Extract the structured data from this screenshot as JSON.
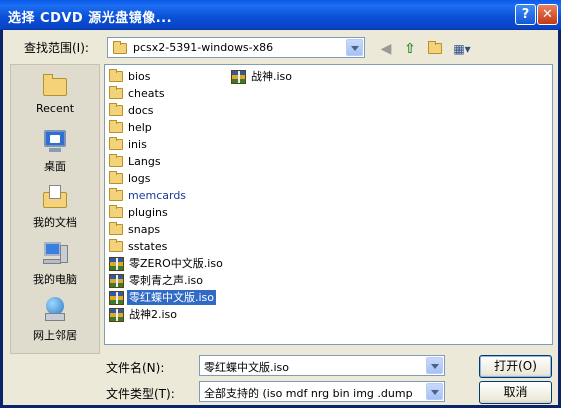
{
  "window": {
    "title": "选择 CDVD 源光盘镜像...",
    "help_glyph": "?",
    "close_glyph": "✕"
  },
  "lookin": {
    "label": "查找范围(I):",
    "value": "pcsx2-5391-windows-x86"
  },
  "toolbar": {
    "back_glyph": "◀",
    "up_glyph": "⇧",
    "view_glyph": "▦▾"
  },
  "places": [
    {
      "label": "Recent",
      "icon": "recent-folder-icon"
    },
    {
      "label": "桌面",
      "icon": "desktop-icon"
    },
    {
      "label": "我的文档",
      "icon": "my-documents-icon"
    },
    {
      "label": "我的电脑",
      "icon": "my-computer-icon"
    },
    {
      "label": "网上邻居",
      "icon": "network-icon"
    }
  ],
  "files": {
    "column1": [
      {
        "name": "bios",
        "type": "folder"
      },
      {
        "name": "cheats",
        "type": "folder"
      },
      {
        "name": "docs",
        "type": "folder"
      },
      {
        "name": "help",
        "type": "folder"
      },
      {
        "name": "inis",
        "type": "folder"
      },
      {
        "name": "Langs",
        "type": "folder"
      },
      {
        "name": "logs",
        "type": "folder"
      },
      {
        "name": "memcards",
        "type": "folder",
        "special": true
      },
      {
        "name": "plugins",
        "type": "folder"
      },
      {
        "name": "snaps",
        "type": "folder"
      },
      {
        "name": "sstates",
        "type": "folder"
      },
      {
        "name": "零ZERO中文版.iso",
        "type": "iso"
      },
      {
        "name": "零刺青之声.iso",
        "type": "iso"
      },
      {
        "name": "零红蝶中文版.iso",
        "type": "iso",
        "selected": true
      },
      {
        "name": "战神2.iso",
        "type": "iso"
      }
    ],
    "column2": [
      {
        "name": "战神.iso",
        "type": "iso"
      }
    ]
  },
  "filename": {
    "label": "文件名(N):",
    "value": "零红蝶中文版.iso"
  },
  "filetype": {
    "label": "文件类型(T):",
    "value": "全部支持的 (iso mdf nrg bin img .dump"
  },
  "buttons": {
    "open": "打开(O)",
    "cancel": "取消"
  },
  "colors": {
    "title_bar": "#0a4fd6",
    "selection": "#316ac5",
    "dialog_bg": "#ece9d8"
  }
}
